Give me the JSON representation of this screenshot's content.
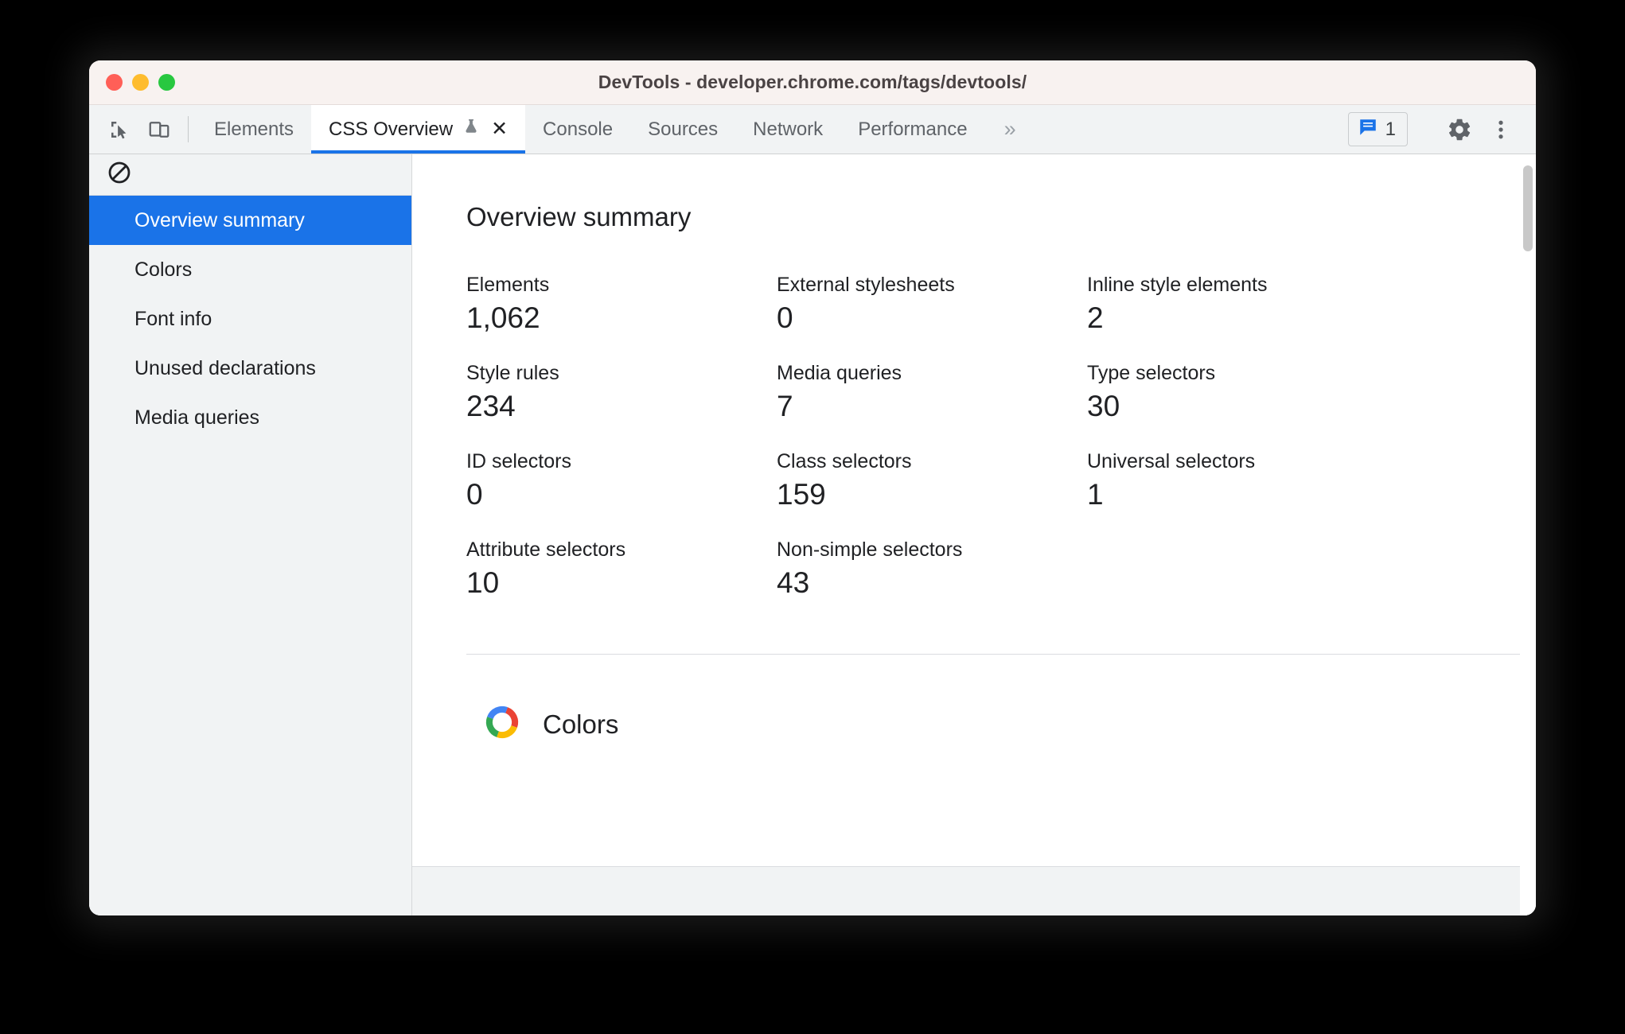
{
  "window": {
    "title": "DevTools - developer.chrome.com/tags/devtools/",
    "traffic_lights": [
      "close",
      "minimize",
      "zoom"
    ],
    "colors": {
      "titlebar_bg": "#f8f2f0",
      "accent": "#1a73e8",
      "tabbar_bg": "#f1f3f4",
      "sidebar_bg": "#f1f3f4",
      "content_bg": "#ffffff",
      "close_red": "#ff5f57",
      "minimize_yellow": "#febc2e",
      "zoom_green": "#28c840"
    }
  },
  "toolbar": {
    "inspect_icon": "inspect-cursor-icon",
    "device_icon": "device-toolbar-icon",
    "tabs": [
      {
        "label": "Elements",
        "active": false,
        "closable": false,
        "experimental": false
      },
      {
        "label": "CSS Overview",
        "active": true,
        "closable": true,
        "experimental": true,
        "flask_icon": "flask-icon",
        "close_glyph": "✕"
      },
      {
        "label": "Console",
        "active": false,
        "closable": false,
        "experimental": false
      },
      {
        "label": "Sources",
        "active": false,
        "closable": false,
        "experimental": false
      },
      {
        "label": "Network",
        "active": false,
        "closable": false,
        "experimental": false
      },
      {
        "label": "Performance",
        "active": false,
        "closable": false,
        "experimental": false
      }
    ],
    "overflow_label": "»",
    "message_badge": {
      "icon": "message-bubble-icon",
      "count": "1"
    },
    "settings_icon": "gear-icon",
    "more_icon": "kebab-menu-icon"
  },
  "sidebar": {
    "clear_icon": "no-entry-icon",
    "items": [
      {
        "label": "Overview summary",
        "selected": true
      },
      {
        "label": "Colors",
        "selected": false
      },
      {
        "label": "Font info",
        "selected": false
      },
      {
        "label": "Unused declarations",
        "selected": false
      },
      {
        "label": "Media queries",
        "selected": false
      }
    ]
  },
  "main": {
    "heading": "Overview summary",
    "stats": [
      {
        "label": "Elements",
        "value": "1,062"
      },
      {
        "label": "External stylesheets",
        "value": "0"
      },
      {
        "label": "Inline style elements",
        "value": "2"
      },
      {
        "label": "Style rules",
        "value": "234"
      },
      {
        "label": "Media queries",
        "value": "7"
      },
      {
        "label": "Type selectors",
        "value": "30"
      },
      {
        "label": "ID selectors",
        "value": "0"
      },
      {
        "label": "Class selectors",
        "value": "159"
      },
      {
        "label": "Universal selectors",
        "value": "1"
      },
      {
        "label": "Attribute selectors",
        "value": "10"
      },
      {
        "label": "Non-simple selectors",
        "value": "43"
      }
    ],
    "colors_section": {
      "icon": "color-wheel-icon",
      "title": "Colors",
      "wheel_colors": [
        "#ea4335",
        "#fbbc04",
        "#34a853",
        "#4285f4"
      ]
    }
  }
}
